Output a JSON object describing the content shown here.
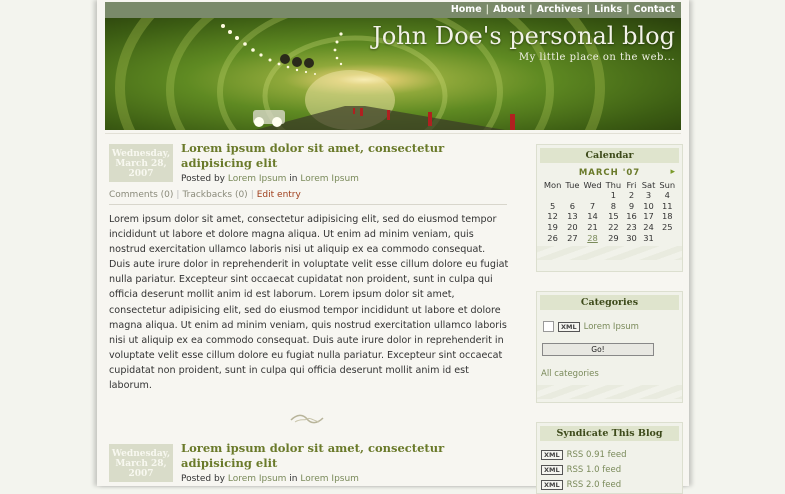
{
  "nav": {
    "items": [
      "Home",
      "About",
      "Archives",
      "Links",
      "Contact"
    ]
  },
  "header": {
    "title": "John Doe's personal blog",
    "subtitle": "My little place on the web..."
  },
  "posts": [
    {
      "date_line1": "Wednesday,",
      "date_line2": "March 28,",
      "date_line3": "2007",
      "title": "Lorem ipsum dolor sit amet, consectetur adipisicing elit",
      "posted_by": "Posted by",
      "author": "Lorem Ipsum",
      "in": "in",
      "category": "Lorem Ipsum",
      "comments": "Comments (0)",
      "trackbacks": "Trackbacks (0)",
      "edit": "Edit entry",
      "body": "Lorem ipsum dolor sit amet, consectetur adipisicing elit, sed do eiusmod tempor incididunt ut labore et dolore magna aliqua. Ut enim ad minim veniam, quis nostrud exercitation ullamco laboris nisi ut aliquip ex ea commodo consequat. Duis aute irure dolor in reprehenderit in voluptate velit esse cillum dolore eu fugiat nulla pariatur. Excepteur sint occaecat cupidatat non proident, sunt in culpa qui officia deserunt mollit anim id est laborum. Lorem ipsum dolor sit amet, consectetur adipisicing elit, sed do eiusmod tempor incididunt ut labore et dolore magna aliqua. Ut enim ad minim veniam, quis nostrud exercitation ullamco laboris nisi ut aliquip ex ea commodo consequat. Duis aute irure dolor in reprehenderit in voluptate velit esse cillum dolore eu fugiat nulla pariatur. Excepteur sint occaecat cupidatat non proident, sunt in culpa qui officia deserunt mollit anim id est laborum."
    },
    {
      "date_line1": "Wednesday,",
      "date_line2": "March 28,",
      "date_line3": "2007",
      "title": "Lorem ipsum dolor sit amet, consectetur adipisicing elit",
      "posted_by": "Posted by",
      "author": "Lorem Ipsum",
      "in": "in",
      "category": "Lorem Ipsum"
    }
  ],
  "calendar": {
    "title": "Calendar",
    "month": "MARCH '07",
    "next": "▸",
    "weekdays": [
      "Mon",
      "Tue",
      "Wed",
      "Thu",
      "Fri",
      "Sat",
      "Sun"
    ],
    "weeks": [
      [
        "",
        "",
        "",
        "1",
        "2",
        "3",
        "4"
      ],
      [
        "5",
        "6",
        "7",
        "8",
        "9",
        "10",
        "11"
      ],
      [
        "12",
        "13",
        "14",
        "15",
        "16",
        "17",
        "18"
      ],
      [
        "19",
        "20",
        "21",
        "22",
        "23",
        "24",
        "25"
      ],
      [
        "26",
        "27",
        "28",
        "29",
        "30",
        "31",
        ""
      ]
    ],
    "linked_day": "28"
  },
  "categories": {
    "title": "Categories",
    "xml": "XML",
    "item": "Lorem Ipsum",
    "go": "Go!",
    "all": "All categories"
  },
  "syndicate": {
    "title": "Syndicate This Blog",
    "xml": "XML",
    "feeds": [
      "RSS 0.91 feed",
      "RSS 1.0 feed",
      "RSS 2.0 feed"
    ]
  },
  "colors": {
    "nav_bg": "#7a8a6a",
    "post_title": "#6a7a2a",
    "link": "#7a8a5a",
    "edit_link": "#a0401e"
  }
}
